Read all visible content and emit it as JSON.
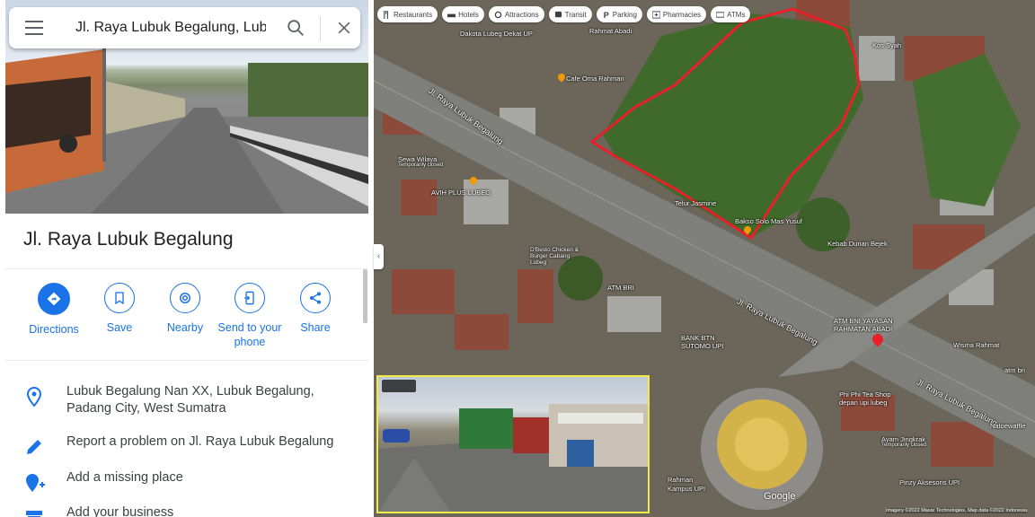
{
  "search": {
    "query": "Jl. Raya Lubuk Begalung, Lubuk"
  },
  "place": {
    "title": "Jl. Raya Lubuk Begalung"
  },
  "actions": [
    {
      "label": "Directions",
      "icon": "directions-icon"
    },
    {
      "label": "Save",
      "icon": "bookmark-icon"
    },
    {
      "label": "Nearby",
      "icon": "nearby-icon"
    },
    {
      "label": "Send to your phone",
      "icon": "send-to-phone-icon"
    },
    {
      "label": "Share",
      "icon": "share-icon"
    }
  ],
  "info": [
    {
      "text": "Lubuk Begalung Nan XX, Lubuk Begalung, Padang City, West Sumatra",
      "icon": "location-pin-icon"
    },
    {
      "text": "Report a problem on Jl. Raya Lubuk Begalung",
      "icon": "pencil-icon"
    },
    {
      "text": "Add a missing place",
      "icon": "add-place-icon"
    },
    {
      "text": "Add your business",
      "icon": "store-icon"
    }
  ],
  "map": {
    "chips": [
      {
        "label": "Restaurants",
        "icon": "fork-knife-icon"
      },
      {
        "label": "Hotels",
        "icon": "bed-icon"
      },
      {
        "label": "Attractions",
        "icon": "camera-icon"
      },
      {
        "label": "Transit",
        "icon": "bus-icon"
      },
      {
        "label": "Parking",
        "icon": "parking-icon"
      },
      {
        "label": "Pharmacies",
        "icon": "pharmacy-icon"
      },
      {
        "label": "ATMs",
        "icon": "atm-icon"
      }
    ],
    "road_label": "Jl. Raya Lubuk Begalung",
    "poi": {
      "dakota": "Dakota Lubeg Dekat UP",
      "cafe": "Cafe Oma Rahman",
      "sewa": "Sewa Wilaya",
      "sewa_status": "Temporarily closed",
      "avih": "AVIH PLUS LUBEG",
      "dbesto": "D'Besto Chicken & Burger Cabang Lubeg",
      "atm_bri": "ATM BRI",
      "bank_btn": "BANK BTN SUTOMO UPI",
      "bakso": "Bakso Solo Mas Yusuf",
      "telur": "Telur Jasmine",
      "kebab": "Kebab Durian Bejek",
      "atm_bni": "ATM BNI YAYASAN RAHMATAN ABADI",
      "wisma": "Wisma Rahmat",
      "phi": "Phi Phi Tea Shop depan upi lubeg",
      "ayam": "Ayam Jingkrak",
      "ayam_status": "Temporarily closed",
      "pinzy": "Pinzy Aksesoris UPI",
      "kos": "Kos Syah",
      "atm_bri2": "atm bri",
      "natoe": "Natoewaffle",
      "rahmat_abadi": "Rahmat Abadi",
      "kampus": "Kampus UPI",
      "rahman": "Rahman"
    },
    "google": "Google",
    "attribution": "Imagery ©2022 Maxar Technologies, Map data ©2022   Indonesia",
    "highlight_color": "#e8202a"
  }
}
